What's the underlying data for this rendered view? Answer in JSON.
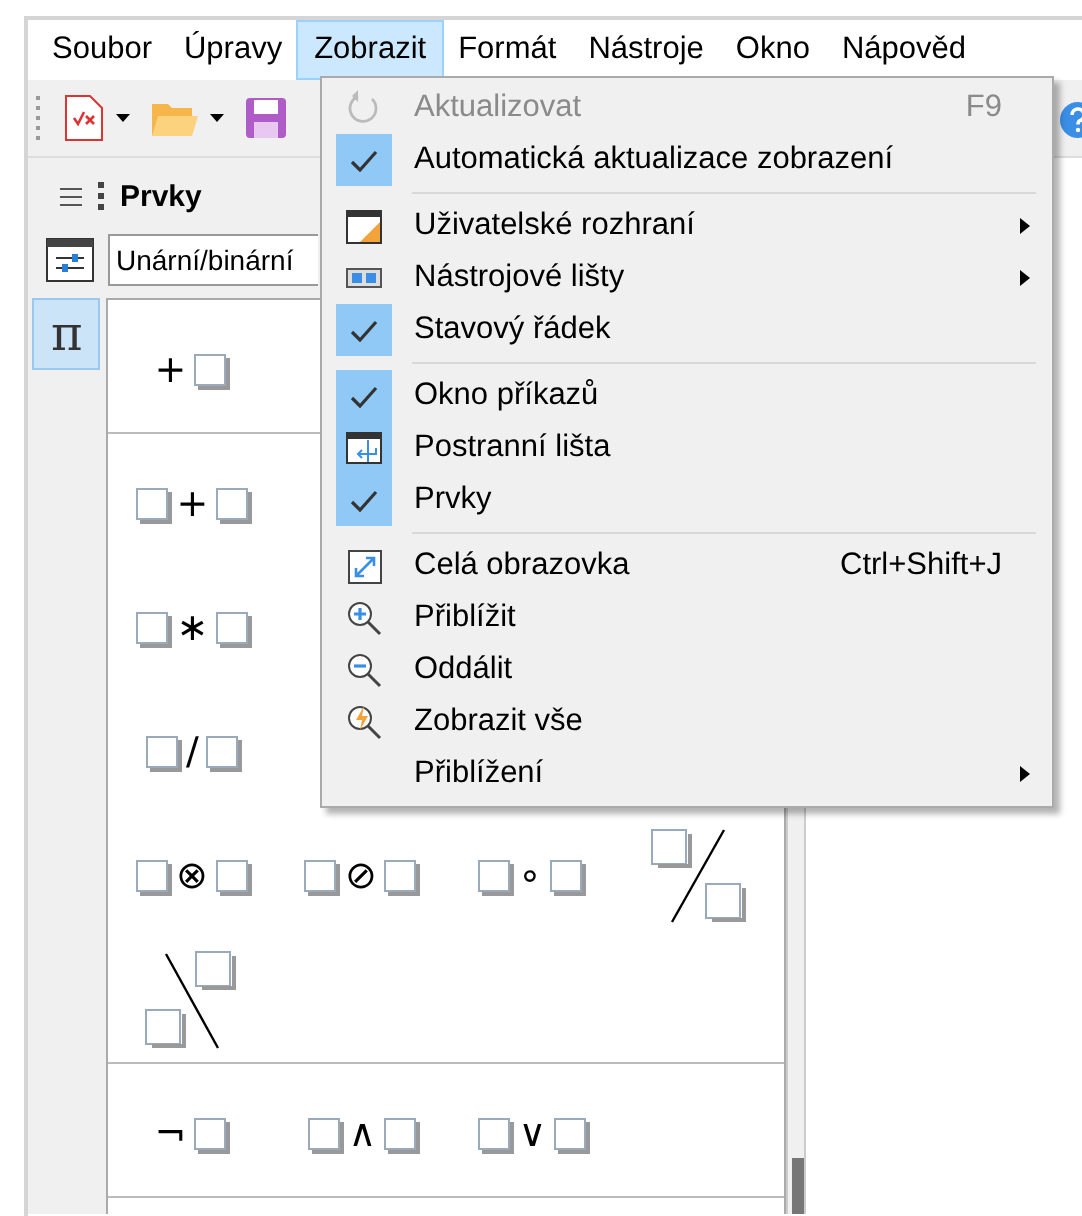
{
  "menu_bar": [
    {
      "label": "Soubor",
      "selected": false
    },
    {
      "label": "Úpravy",
      "selected": false
    },
    {
      "label": "Zobrazit",
      "selected": true
    },
    {
      "label": "Formát",
      "selected": false
    },
    {
      "label": "Nástroje",
      "selected": false
    },
    {
      "label": "Okno",
      "selected": false
    },
    {
      "label": "Nápověd",
      "selected": false
    }
  ],
  "elements_panel": {
    "title": "Prvky",
    "category": "Unární/binární",
    "category_tabs": [
      {
        "symbol": "π",
        "selected": true
      }
    ],
    "sections": [
      {
        "rows": [
          [
            {
              "kind": "prefix",
              "symbol": "+"
            }
          ]
        ]
      },
      {
        "rows": [
          [
            {
              "kind": "infix",
              "symbol": "+"
            }
          ],
          [
            {
              "kind": "infix",
              "symbol": "∗"
            }
          ],
          [
            {
              "kind": "infix",
              "symbol": "/"
            }
          ],
          [
            {
              "kind": "infix",
              "symbol": "⊗"
            },
            {
              "kind": "infix",
              "symbol": "⊘"
            },
            {
              "kind": "infix",
              "symbol": "∘"
            },
            {
              "kind": "slash"
            }
          ],
          [
            {
              "kind": "backslash"
            }
          ]
        ]
      },
      {
        "rows": [
          [
            {
              "kind": "prefix",
              "symbol": "¬"
            },
            {
              "kind": "infix",
              "symbol": "∧"
            },
            {
              "kind": "infix",
              "symbol": "∨"
            }
          ]
        ]
      }
    ]
  },
  "view_menu": {
    "items": [
      {
        "kind": "item",
        "label": "Aktualizovat",
        "checked": false,
        "disabled": true,
        "shortcut": "F9",
        "submenu": false
      },
      {
        "kind": "item",
        "label": "Automatická aktualizace zobrazení",
        "checked": true,
        "disabled": false,
        "submenu": false
      },
      {
        "kind": "separator"
      },
      {
        "kind": "item",
        "label": "Uživatelské rozhraní",
        "checked": false,
        "disabled": false,
        "submenu": true
      },
      {
        "kind": "item",
        "label": "Nástrojové lišty",
        "checked": false,
        "disabled": false,
        "submenu": true
      },
      {
        "kind": "item",
        "label": "Stavový řádek",
        "checked": true,
        "disabled": false,
        "submenu": false
      },
      {
        "kind": "separator"
      },
      {
        "kind": "item",
        "label": "Okno příkazů",
        "checked": true,
        "disabled": false,
        "submenu": false
      },
      {
        "kind": "item",
        "label": "Postranní lišta",
        "checked": true,
        "disabled": false,
        "submenu": false
      },
      {
        "kind": "item",
        "label": "Prvky",
        "checked": true,
        "disabled": false,
        "submenu": false
      },
      {
        "kind": "separator"
      },
      {
        "kind": "item",
        "label": "Celá obrazovka",
        "checked": false,
        "disabled": false,
        "shortcut": "Ctrl+Shift+J",
        "submenu": false
      },
      {
        "kind": "item",
        "label": "Přiblížit",
        "checked": false,
        "disabled": false,
        "submenu": false
      },
      {
        "kind": "item",
        "label": "Oddálit",
        "checked": false,
        "disabled": false,
        "submenu": false
      },
      {
        "kind": "item",
        "label": "Zobrazit vše",
        "checked": false,
        "disabled": false,
        "submenu": false
      },
      {
        "kind": "item",
        "label": "Přiblížení",
        "checked": false,
        "disabled": false,
        "submenu": true
      }
    ]
  }
}
